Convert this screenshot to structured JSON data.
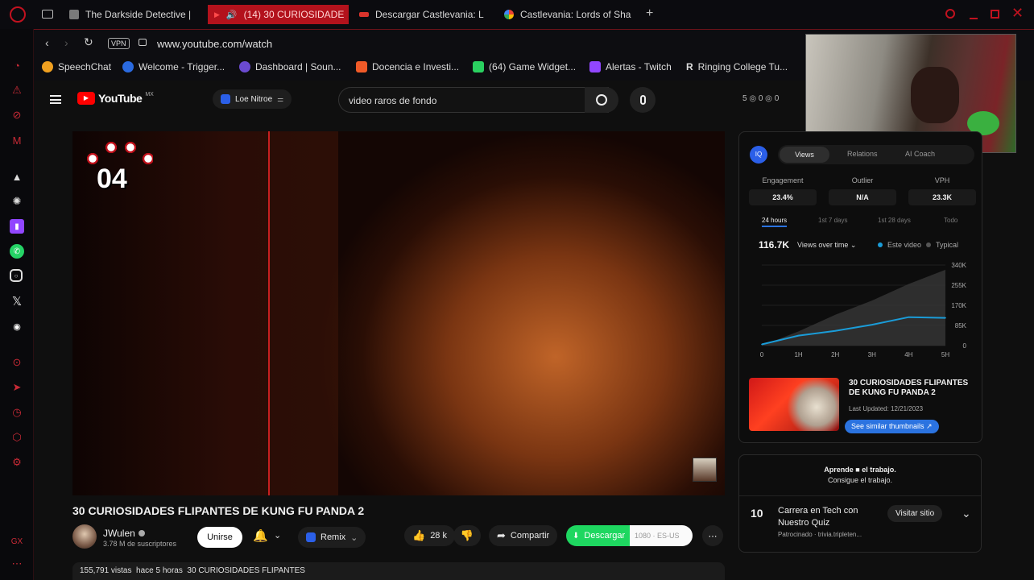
{
  "tabs": [
    {
      "label": "The Darkside Detective | ",
      "color": "#7a7a7a"
    },
    {
      "label": "(14) 30 CURIOSIDADE",
      "color": "#ff2a2a"
    },
    {
      "label": "Descargar Castlevania: L",
      "color": "#d8342c"
    },
    {
      "label": "Castlevania: Lords of Sha",
      "color": "#4aa3f0"
    }
  ],
  "address": {
    "vpn": "VPN",
    "url": "www.youtube.com/watch"
  },
  "bookmarks": [
    "SpeechChat",
    "Welcome - Trigger...",
    "Dashboard | Soun...",
    "Docencia e Investi...",
    "(64) Game Widget...",
    "Alertas - Twitch",
    "Ringing College Tu..."
  ],
  "yt": {
    "logo": "YouTube",
    "region": "MX",
    "extension_label": "Loe Nitroe",
    "search": {
      "value": "video raros de fondo"
    },
    "header_stats": "5 ◎ 0 ◎ 0"
  },
  "video": {
    "overlay_number": "04",
    "title": "30 CURIOSIDADES FLIPANTES DE KUNG FU PANDA 2",
    "channel": "JWulen",
    "subscribers": "3.78 M de suscriptores",
    "join_label": "Unirse",
    "remix_label": "Remix",
    "likes": "28 k",
    "share_label": "Compartir",
    "download_label": "Descargar",
    "download_quality": "1080 · ES-US",
    "desc_line": "155,791 vistas  hace 5 horas  30 CURIOSIDADES FLIPANTES"
  },
  "analytics": {
    "tabs": [
      "Views",
      "Relations",
      "AI Coach"
    ],
    "metrics": [
      {
        "label": "Engagement",
        "value": "23.4%"
      },
      {
        "label": "Outlier",
        "value": "N/A"
      },
      {
        "label": "VPH",
        "value": "23.3K"
      }
    ],
    "periods": [
      "24 hours",
      "1st 7 days",
      "1st 28 days",
      "Todo"
    ],
    "total_views": "116.7K",
    "views_dropdown": "Views over time",
    "legend": [
      "Este video",
      "Typical"
    ],
    "thumb_title": "30 CURIOSIDADES FLIPANTES DE KUNG FU PANDA 2",
    "last_updated": "Last Updated: 12/21/2023",
    "similar_button": "See similar thumbnails ↗"
  },
  "chart_data": {
    "type": "line",
    "x": [
      "0",
      "1H",
      "2H",
      "3H",
      "4H",
      "5H"
    ],
    "yticks": [
      "340K",
      "255K",
      "170K",
      "85K",
      "0"
    ],
    "ylim": [
      0,
      340000
    ],
    "series": [
      {
        "name": "Este video",
        "values": [
          5000,
          42000,
          62000,
          88000,
          120000,
          117000
        ]
      },
      {
        "name": "Typical",
        "values": [
          0,
          60000,
          130000,
          190000,
          260000,
          320000
        ]
      }
    ]
  },
  "ad": {
    "promo_line1": "Aprende ■ el trabajo.",
    "promo_line2": "Consigue el trabajo.",
    "title_line1": "Carrera en Tech con",
    "title_line2": "Nuestro Quiz",
    "sponsor": "Patrocinado · trivia.tripleten...",
    "cta": "Visitar sitio",
    "logo_text": "10"
  },
  "colors": {
    "accent": "#c1121f",
    "ytred": "#ff0000",
    "download": "#1ed760",
    "chart_line": "#1a9cd8"
  }
}
